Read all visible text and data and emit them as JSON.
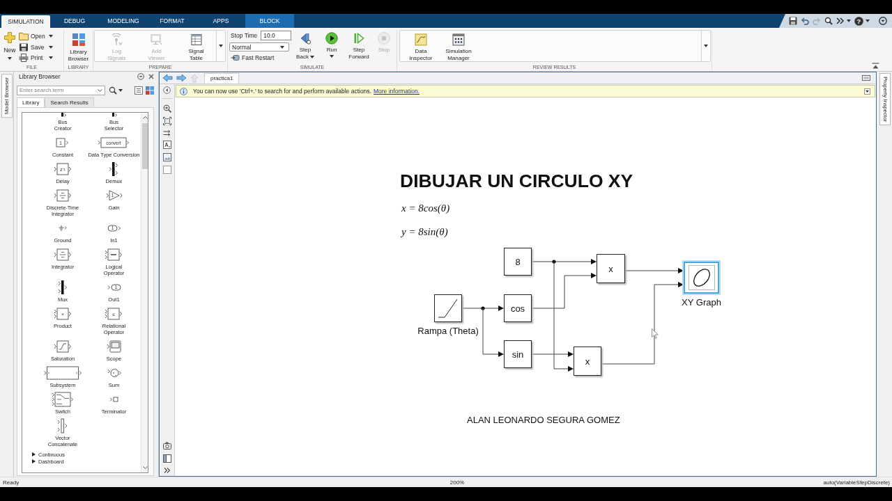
{
  "ribbon_tabs": [
    {
      "label": "SIMULATION",
      "kind": "standard",
      "selected": true
    },
    {
      "label": "DEBUG",
      "kind": "standard",
      "selected": false
    },
    {
      "label": "MODELING",
      "kind": "standard",
      "selected": false
    },
    {
      "label": "FORMAT",
      "kind": "standard",
      "selected": false
    },
    {
      "label": "APPS",
      "kind": "standard",
      "selected": false
    },
    {
      "label": "BLOCK",
      "kind": "contextual",
      "selected": false
    }
  ],
  "quick_access": {
    "help": "?"
  },
  "ribbon": {
    "file": {
      "title": "FILE",
      "new": "New",
      "items": [
        {
          "label": "Open",
          "kind": "open"
        },
        {
          "label": "Save",
          "kind": "save"
        },
        {
          "label": "Print",
          "kind": "print"
        }
      ]
    },
    "library": {
      "title": "LIBRARY",
      "button": "Library Browser"
    },
    "prepare": {
      "title": "PREPARE",
      "buttons": [
        {
          "label": "Log Signals",
          "kind": "log_signals",
          "disabled": true
        },
        {
          "label": "Add Viewer",
          "kind": "add_viewer",
          "disabled": true
        },
        {
          "label": "Signal Table",
          "kind": "signal_table",
          "disabled": false
        }
      ]
    },
    "simulate": {
      "title": "SIMULATE",
      "stop_time_label": "Stop Time",
      "stop_time": "10.0",
      "mode": "Normal",
      "fast_restart": "Fast Restart",
      "buttons": [
        {
          "label": "Step Back",
          "kind": "step_back",
          "menu": true,
          "disabled": false
        },
        {
          "label": "Run",
          "kind": "run",
          "menu": true,
          "disabled": false
        },
        {
          "label": "Step Forward",
          "kind": "step_forward",
          "menu": false,
          "disabled": false
        },
        {
          "label": "Stop",
          "kind": "stop",
          "menu": false,
          "disabled": true
        }
      ]
    },
    "review": {
      "title": "REVIEW RESULTS",
      "buttons": [
        {
          "label": "Data Inspector",
          "kind": "data_inspector"
        },
        {
          "label": "Simulation Manager",
          "kind": "simulation_manager"
        }
      ]
    }
  },
  "side_tabs": {
    "left": "Model Browser",
    "right": "Property Inspector"
  },
  "library_browser": {
    "title": "Library Browser",
    "search": {
      "placeholder": "Enter search term"
    },
    "tabs": [
      {
        "label": "Library",
        "selected": true
      },
      {
        "label": "Search Results",
        "selected": false
      }
    ],
    "blocks": [
      {
        "name": "Bus\nCreator",
        "kind": "bus"
      },
      {
        "name": "Bus\nSelector",
        "kind": "bus"
      },
      {
        "name": "Constant",
        "kind": "source",
        "icon_text": "1"
      },
      {
        "name": "Data Type Conversion",
        "kind": "wide",
        "icon_text": "convert"
      },
      {
        "name": "Delay",
        "kind": "box",
        "icon_text": "z⁻¹"
      },
      {
        "name": "Demux",
        "kind": "demux"
      },
      {
        "name": "Discrete-Time\nIntegrator",
        "kind": "box"
      },
      {
        "name": "Gain",
        "kind": "gain",
        "icon_text": "1"
      },
      {
        "name": "Ground",
        "kind": "ground"
      },
      {
        "name": "In1",
        "kind": "port_in",
        "icon_text": "1"
      },
      {
        "name": "Integrator",
        "kind": "box"
      },
      {
        "name": "Logical\nOperator",
        "kind": "box2"
      },
      {
        "name": "Mux",
        "kind": "mux"
      },
      {
        "name": "Out1",
        "kind": "port_out",
        "icon_text": "1"
      },
      {
        "name": "Product",
        "kind": "box2",
        "icon_text": "×"
      },
      {
        "name": "Relational\nOperator",
        "kind": "box2",
        "icon_text": "≤"
      },
      {
        "name": "Saturation",
        "kind": "saturation"
      },
      {
        "name": "Scope",
        "kind": "scope"
      },
      {
        "name": "Subsystem",
        "kind": "subsystem"
      },
      {
        "name": "Sum",
        "kind": "sum"
      },
      {
        "name": "Switch",
        "kind": "switch"
      },
      {
        "name": "Terminator",
        "kind": "terminator"
      },
      {
        "name": "Vector\nConcatenate",
        "kind": "concat"
      }
    ],
    "folders": [
      {
        "label": "Continuous",
        "expanded": false
      },
      {
        "label": "Dashboard",
        "expanded": false
      }
    ]
  },
  "editor": {
    "tab": "practica1",
    "notice": {
      "text": "You can now use 'Ctrl+.' to search for and perform available actions.",
      "link": "More information."
    }
  },
  "diagram": {
    "title": "DIBUJAR UN CIRCULO XY",
    "equations": [
      "x = 8cos(θ)",
      "y = 8sin(θ)"
    ],
    "blocks": [
      {
        "kind": "ramp",
        "label": "Rampa (Theta)",
        "selected": false
      },
      {
        "kind": "constant",
        "text": "8",
        "selected": false
      },
      {
        "kind": "function",
        "text": "cos",
        "selected": false
      },
      {
        "kind": "function",
        "text": "sin",
        "selected": false
      },
      {
        "kind": "product",
        "text": "x",
        "selected": false
      },
      {
        "kind": "product",
        "text": "x",
        "selected": false
      },
      {
        "kind": "xy_graph",
        "label": "XY Graph",
        "selected": true
      }
    ],
    "author": "ALAN LEONARDO SEGURA GOMEZ"
  },
  "status_bar": {
    "left": "Ready",
    "zoom": "200%",
    "solver": "auto(VariableStepDiscrete)"
  }
}
